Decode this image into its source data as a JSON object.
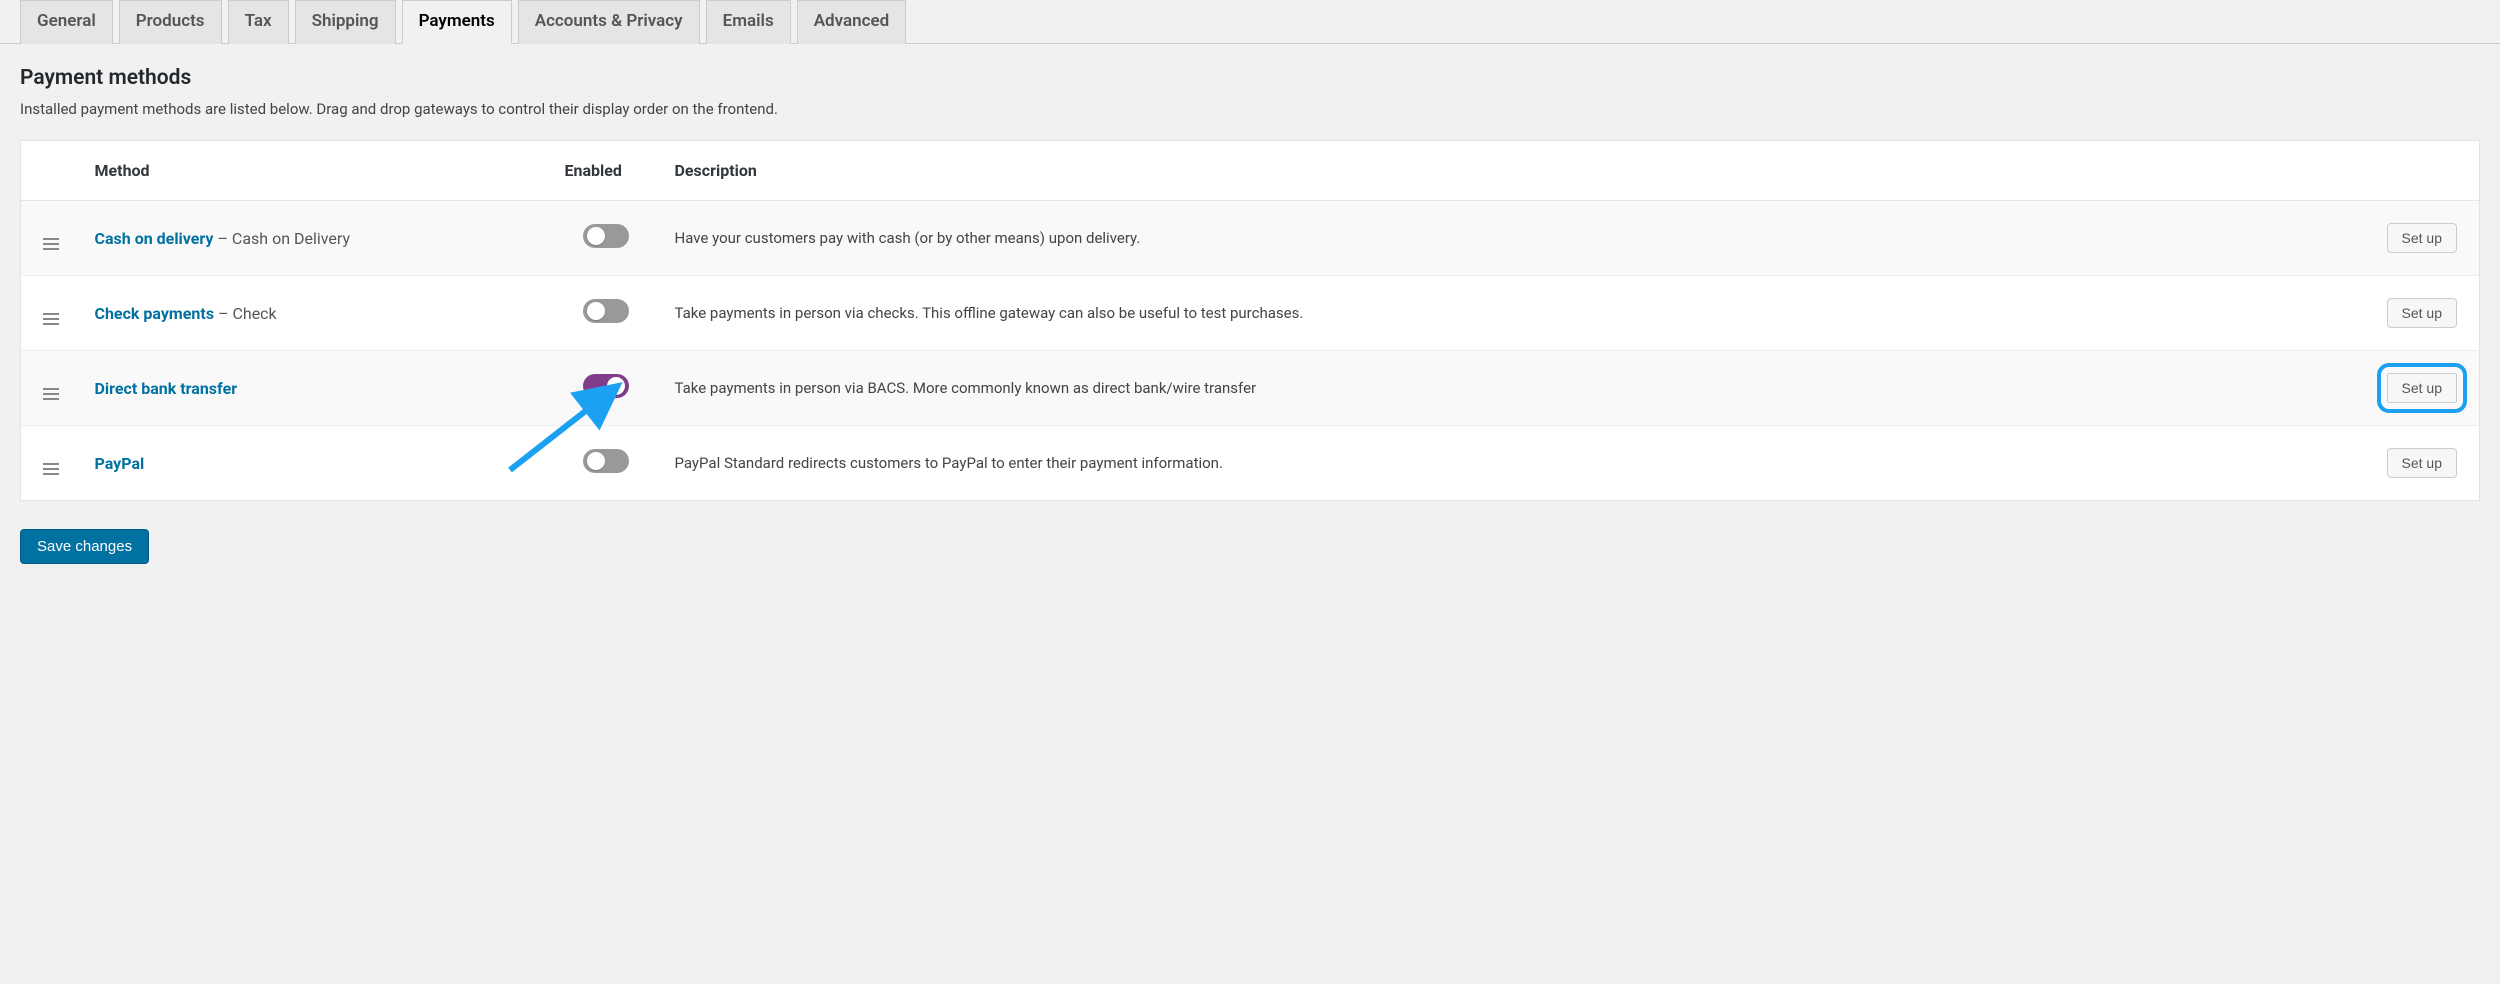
{
  "tabs": [
    {
      "label": "General"
    },
    {
      "label": "Products"
    },
    {
      "label": "Tax"
    },
    {
      "label": "Shipping"
    },
    {
      "label": "Payments",
      "active": true
    },
    {
      "label": "Accounts & Privacy"
    },
    {
      "label": "Emails"
    },
    {
      "label": "Advanced"
    }
  ],
  "section": {
    "title": "Payment methods",
    "description": "Installed payment methods are listed below. Drag and drop gateways to control their display order on the frontend."
  },
  "table": {
    "columns": {
      "method": "Method",
      "enabled": "Enabled",
      "description": "Description"
    },
    "rows": [
      {
        "name": "Cash on delivery",
        "suffix": " – Cash on Delivery",
        "enabled": false,
        "description": "Have your customers pay with cash (or by other means) upon delivery.",
        "action": "Set up",
        "highlight": false
      },
      {
        "name": "Check payments",
        "suffix": " – Check",
        "enabled": false,
        "description": "Take payments in person via checks. This offline gateway can also be useful to test purchases.",
        "action": "Set up",
        "highlight": false
      },
      {
        "name": "Direct bank transfer",
        "suffix": "",
        "enabled": true,
        "description": "Take payments in person via BACS. More commonly known as direct bank/wire transfer",
        "action": "Set up",
        "highlight": true
      },
      {
        "name": "PayPal",
        "suffix": "",
        "enabled": false,
        "description": "PayPal Standard redirects customers to PayPal to enter their payment information.",
        "action": "Set up",
        "highlight": false
      }
    ]
  },
  "buttons": {
    "save": "Save changes"
  },
  "annotations": {
    "arrow_color": "#1ca0f2"
  }
}
